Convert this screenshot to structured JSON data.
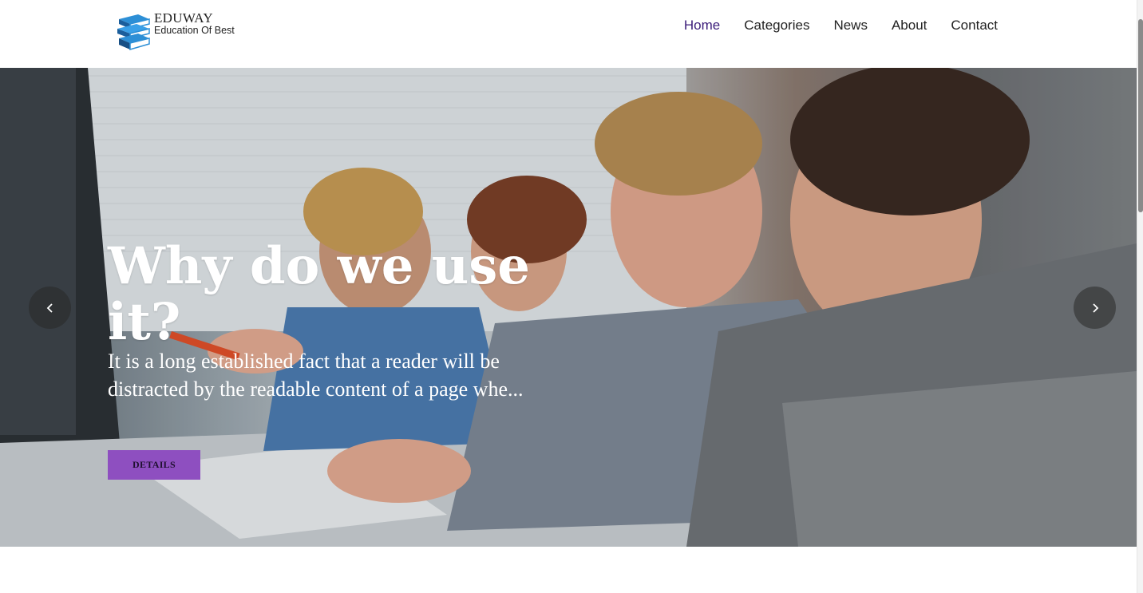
{
  "brand": {
    "name": "EDUWAY",
    "tagline": "Education Of Best",
    "logo_icon": "books-stack-icon"
  },
  "nav": {
    "items": [
      {
        "label": "Home",
        "active": true
      },
      {
        "label": "Categories",
        "active": false
      },
      {
        "label": "News",
        "active": false
      },
      {
        "label": "About",
        "active": false
      },
      {
        "label": "Contact",
        "active": false
      }
    ]
  },
  "hero": {
    "title": "Why do we use it?",
    "text": "It is a long established fact that a reader will be distracted by the readable content of a page whe...",
    "button_label": "DETAILS",
    "prev_icon": "chevron-left-icon",
    "next_icon": "chevron-right-icon"
  },
  "colors": {
    "active_nav": "#3b1c7a",
    "button_bg": "#8e4fc0"
  }
}
